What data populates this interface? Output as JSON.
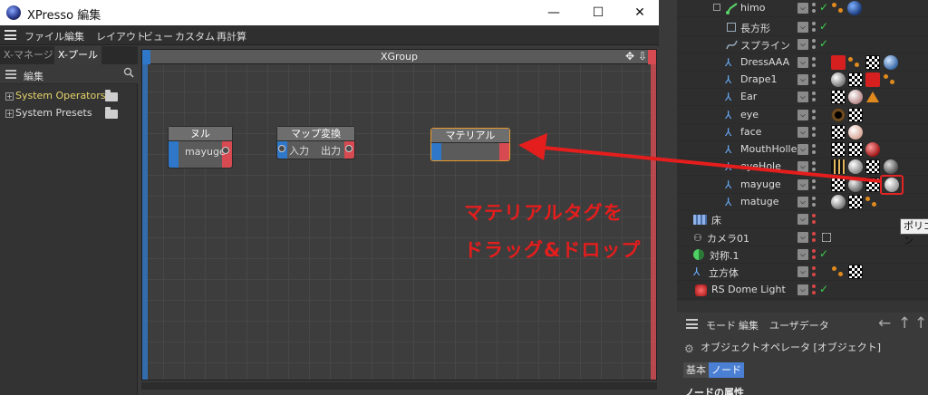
{
  "window": {
    "title": "XPresso 編集",
    "controls": {
      "minimize": "—",
      "maximize": "☐",
      "close": "✕"
    }
  },
  "menubar": [
    "ファイル",
    "編集",
    "レイアウト",
    "ビュー",
    "カスタム",
    "再計算"
  ],
  "pool": {
    "tabs": [
      "X-マネージャ",
      "X-プール"
    ],
    "toolbar_label": "編集",
    "items": [
      "System Operators",
      "System Presets"
    ]
  },
  "xgroup": {
    "name": "XGroup",
    "nodes": [
      {
        "title": "ヌル",
        "output_port": "mayuge"
      },
      {
        "title": "マップ変換",
        "input_port": "入力",
        "output_port": "出力"
      },
      {
        "title": "マテリアル"
      }
    ]
  },
  "annotation": {
    "line1": "マテリアルタグを",
    "line2": "ドラッグ&ドロップ",
    "color": "#e41d1d"
  },
  "object_manager": {
    "rows": [
      {
        "name": "himo",
        "icon": "spline-icon",
        "check": true,
        "tags": [
          "orange",
          "blue-ball"
        ]
      },
      {
        "name": "長方形",
        "icon": "rectangle-icon",
        "check": true,
        "tags": []
      },
      {
        "name": "スプライン",
        "icon": "spline-icon",
        "check": true,
        "tags": []
      },
      {
        "name": "DressAAA",
        "icon": "joint-icon",
        "check": false,
        "tags": [
          "red-cube",
          "orange",
          "checker",
          "ball"
        ]
      },
      {
        "name": "Drape1",
        "icon": "joint-icon",
        "check": false,
        "tags": [
          "ball",
          "checker",
          "red-cube",
          "orange"
        ]
      },
      {
        "name": "Ear",
        "icon": "joint-icon",
        "check": false,
        "tags": [
          "checker",
          "pink-ball",
          "orange-triangle"
        ]
      },
      {
        "name": "eye",
        "icon": "joint-icon",
        "check": false,
        "tags": [
          "eye-ball",
          "checker"
        ]
      },
      {
        "name": "face",
        "icon": "joint-icon",
        "check": false,
        "tags": [
          "checker",
          "ball"
        ]
      },
      {
        "name": "MouthHolle",
        "icon": "joint-icon",
        "check": false,
        "tags": [
          "checker",
          "checker",
          "red-ball"
        ]
      },
      {
        "name": "eyeHole",
        "icon": "joint-icon",
        "check": false,
        "tags": [
          "clapper",
          "ball",
          "checker",
          "ball"
        ]
      },
      {
        "name": "mayuge",
        "icon": "joint-icon",
        "check": false,
        "tags": [
          "checker",
          "ball",
          "checker",
          "white-ball"
        ]
      },
      {
        "name": "matuge",
        "icon": "joint-icon",
        "check": false,
        "tags": [
          "ball",
          "checker",
          "orange"
        ]
      },
      {
        "name": "床",
        "icon": "floor-icon",
        "check": false,
        "tags": []
      },
      {
        "name": "カメラ01",
        "icon": "camera-icon",
        "check": false,
        "tags": []
      },
      {
        "name": "対称.1",
        "icon": "symmetry-icon",
        "check": true,
        "tags": []
      },
      {
        "name": "立方体",
        "icon": "joint-icon",
        "check": false,
        "tags": [
          "orange",
          "checker"
        ]
      },
      {
        "name": "RS Dome Light",
        "icon": "dome-light-icon",
        "check": true,
        "tags": []
      }
    ],
    "tooltip": "ポリゴン"
  },
  "attributes": {
    "menu": [
      "モード",
      "編集",
      "ユーザデータ"
    ],
    "object_line": "オブジェクトオペレータ [オブジェクト]",
    "tabs": [
      "基本",
      "ノード"
    ],
    "section": "ノードの属性"
  }
}
